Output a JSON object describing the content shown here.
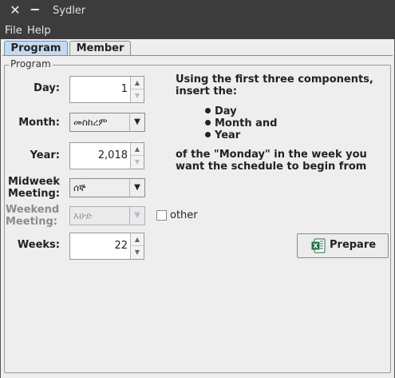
{
  "window": {
    "title": "Sydler",
    "close_icon": "close-icon",
    "minimize_icon": "minimize-icon"
  },
  "menu": {
    "file": "File",
    "help": "Help"
  },
  "tabs": [
    {
      "label": "Program",
      "active": true
    },
    {
      "label": "Member",
      "active": false
    }
  ],
  "program": {
    "legend": "Program",
    "day": {
      "label": "Day:",
      "value": "1"
    },
    "month": {
      "label": "Month:",
      "value": "መስከረም"
    },
    "year": {
      "label": "Year:",
      "value": "2,018"
    },
    "midweek": {
      "label_line1": "Midweek",
      "label_line2": "Meeting:",
      "value": "ሰኞ"
    },
    "weekend": {
      "label_line1": "Weekend",
      "label_line2": "Meeting:",
      "value": "እሁድ",
      "disabled": true
    },
    "other": {
      "label": "other",
      "checked": false
    },
    "weeks": {
      "label": "Weeks:",
      "value": "22"
    },
    "instructions": {
      "line1": "Using the first three components,",
      "line2": "insert the:",
      "bullets": [
        "Day",
        "Month and",
        "Year"
      ],
      "line3": "of the \"Monday\" in the week you",
      "line4": "want the schedule to begin from"
    },
    "prepare_button": {
      "label": "Prepare",
      "icon": "excel-icon",
      "icon_color": "#1e7145"
    }
  },
  "colors": {
    "active_tab": "#c5daf0",
    "titlebar": "#3c3c3c",
    "window_bg": "#eeeeee"
  }
}
